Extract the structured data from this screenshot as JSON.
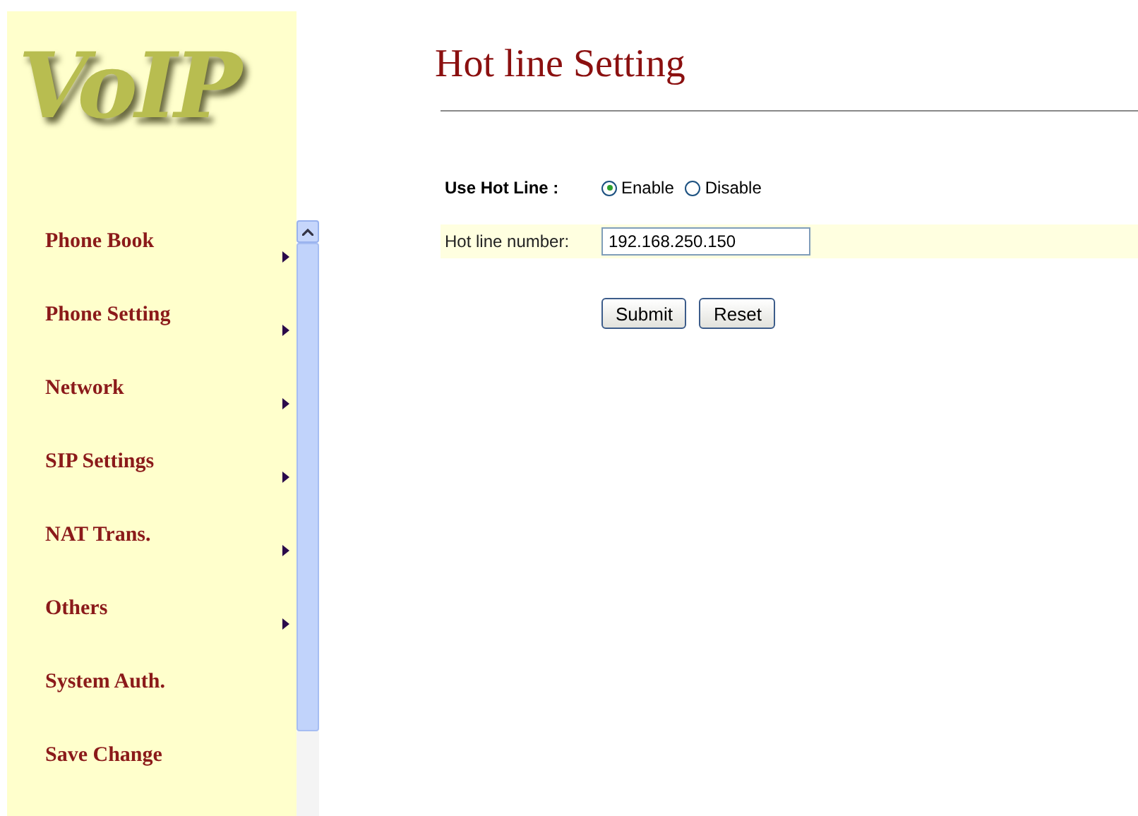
{
  "sidebar": {
    "logo": "VoIP",
    "items": [
      {
        "label": "Phone Book",
        "has_submenu": true
      },
      {
        "label": "Phone Setting",
        "has_submenu": true
      },
      {
        "label": "Network",
        "has_submenu": true
      },
      {
        "label": "SIP Settings",
        "has_submenu": true
      },
      {
        "label": "NAT Trans.",
        "has_submenu": true
      },
      {
        "label": "Others",
        "has_submenu": true
      },
      {
        "label": "System Auth.",
        "has_submenu": false
      },
      {
        "label": "Save Change",
        "has_submenu": false
      }
    ]
  },
  "page": {
    "title": "Hot line Setting",
    "use_hot_line": {
      "label": "Use Hot Line :",
      "options": [
        {
          "label": "Enable",
          "selected": true
        },
        {
          "label": "Disable",
          "selected": false
        }
      ]
    },
    "hot_line_number": {
      "label": "Hot line number:",
      "value": "192.168.250.150"
    },
    "buttons": [
      "Submit",
      "Reset"
    ]
  }
}
